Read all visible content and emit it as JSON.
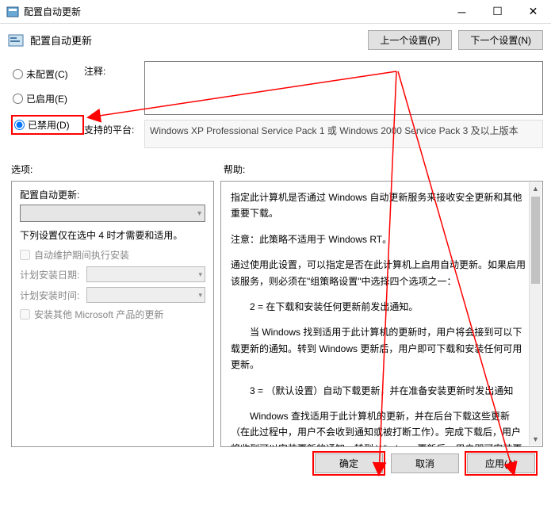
{
  "window": {
    "title": "配置自动更新"
  },
  "header": {
    "title": "配置自动更新",
    "prev_btn": "上一个设置(P)",
    "next_btn": "下一个设置(N)"
  },
  "radios": {
    "not_configured": "未配置(C)",
    "enabled": "已启用(E)",
    "disabled": "已禁用(D)"
  },
  "fields": {
    "comment_label": "注释:",
    "platform_label": "支持的平台:",
    "platform_text": "Windows XP Professional Service Pack 1 或 Windows 2000 Service Pack 3 及以上版本"
  },
  "section": {
    "options_label": "选项:",
    "help_label": "帮助:"
  },
  "options": {
    "config_label": "配置自动更新:",
    "note": "下列设置仅在选中 4 时才需要和适用。",
    "auto_maint": "自动维护期间执行安装",
    "schedule_date": "计划安装日期:",
    "schedule_time": "计划安装时间:",
    "other_ms": "安装其他 Microsoft 产品的更新"
  },
  "help": {
    "p1": "指定此计算机是否通过 Windows 自动更新服务来接收安全更新和其他重要下载。",
    "p2": "注意：此策略不适用于 Windows RT。",
    "p3": "通过使用此设置，可以指定是否在此计算机上启用自动更新。如果启用该服务，则必须在\"组策略设置\"中选择四个选项之一：",
    "p4": "2 = 在下载和安装任何更新前发出通知。",
    "p5": "当 Windows 找到适用于此计算机的更新时，用户将会接到可以下载更新的通知。转到 Windows 更新后，用户即可下载和安装任何可用更新。",
    "p6": "3 = （默认设置）自动下载更新，并在准备安装更新时发出通知",
    "p7": "Windows 查找适用于此计算机的更新，并在后台下载这些更新（在此过程中，用户不会收到通知或被打断工作）。完成下载后，用户将收到可以安装更新的通知。转到 Windows 更新后，用户即可安装更新。"
  },
  "footer": {
    "ok": "确定",
    "cancel": "取消",
    "apply": "应用(A)"
  }
}
